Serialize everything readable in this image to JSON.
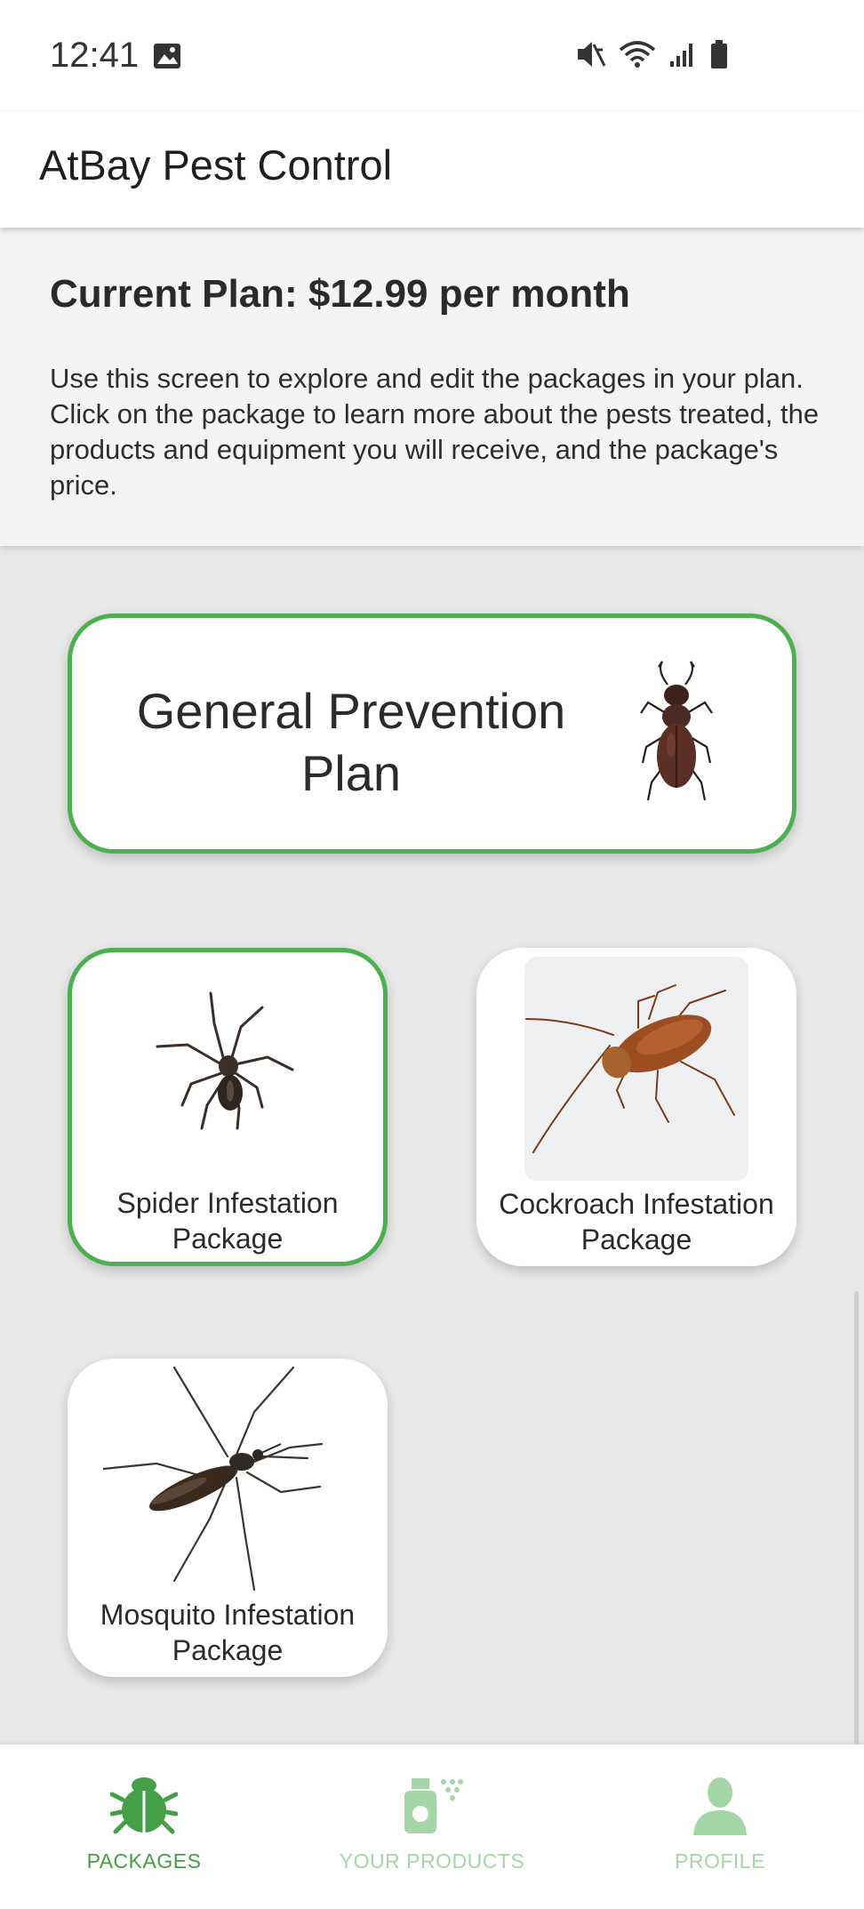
{
  "status_bar": {
    "time": "12:41",
    "icons": [
      "gallery-icon",
      "mute-icon",
      "wifi-icon",
      "signal-icon",
      "battery-icon"
    ]
  },
  "app_bar": {
    "title": "AtBay Pest Control"
  },
  "plan": {
    "heading": "Current Plan: $12.99 per month",
    "description": "Use this screen to explore and edit the packages in your plan. Click on the package to learn more about the pests treated, the products and equipment you will receive, and the package's price."
  },
  "packages": {
    "general": {
      "label_line1": "General Prevention",
      "label_line2": "Plan",
      "selected": true,
      "image": "stag-beetle-image"
    },
    "spider": {
      "label_line1": "Spider Infestation",
      "label_line2": "Package",
      "selected": true,
      "image": "spider-image"
    },
    "cockroach": {
      "label_line1": "Cockroach Infestation",
      "label_line2": "Package",
      "selected": false,
      "image": "cockroach-image"
    },
    "mosquito": {
      "label_line1": "Mosquito Infestation",
      "label_line2": "Package",
      "selected": false,
      "image": "mosquito-image"
    }
  },
  "bottom_nav": {
    "items": [
      {
        "label": "PACKAGES",
        "icon": "bug-icon",
        "active": true
      },
      {
        "label": "YOUR PRODUCTS",
        "icon": "spray-bottle-icon",
        "active": false
      },
      {
        "label": "PROFILE",
        "icon": "person-icon",
        "active": false
      }
    ]
  },
  "colors": {
    "accent": "#4caf50",
    "accent_dark": "#43a047",
    "inactive_nav": "#a5d6a7",
    "page_bg": "#e8e8e8"
  }
}
